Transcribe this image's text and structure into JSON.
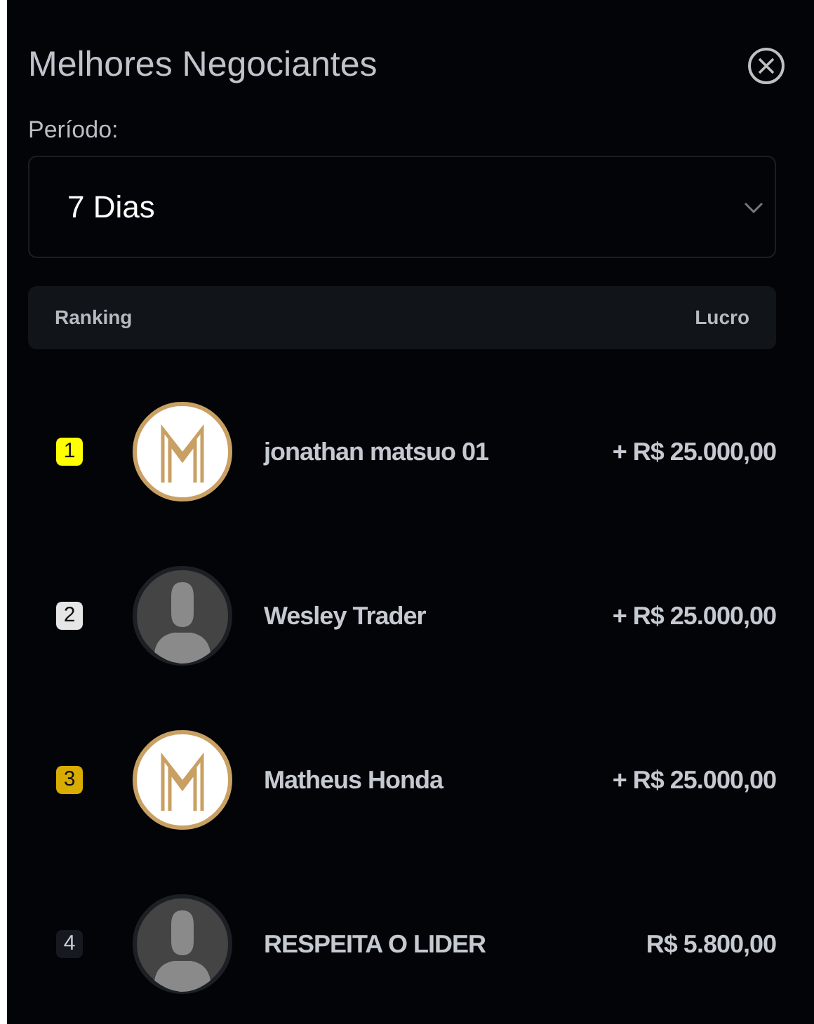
{
  "title": "Melhores Negociantes",
  "period": {
    "label": "Período:",
    "value": "7 Dias"
  },
  "table": {
    "columns": [
      "Ranking",
      "Lucro"
    ],
    "rows": [
      {
        "rank": "1",
        "color": "#ffff00",
        "avatar": {
          "kind": "logo"
        },
        "name": "jonathan matsuo 01",
        "profit": "+ R$ 25.000,00"
      },
      {
        "rank": "2",
        "color": "#e6e6e6",
        "avatar": {
          "kind": "silhouette"
        },
        "name": "Wesley Trader",
        "profit": "+ R$ 25.000,00"
      },
      {
        "rank": "3",
        "color": "#d9ad00",
        "avatar": {
          "kind": "logo"
        },
        "name": "Matheus Honda",
        "profit": "+ R$ 25.000,00"
      },
      {
        "rank": "4",
        "color": "#161a20",
        "avatar": {
          "kind": "silhouette"
        },
        "name": "RESPEITA O LIDER",
        "profit": "R$ 5.800,00"
      }
    ]
  }
}
